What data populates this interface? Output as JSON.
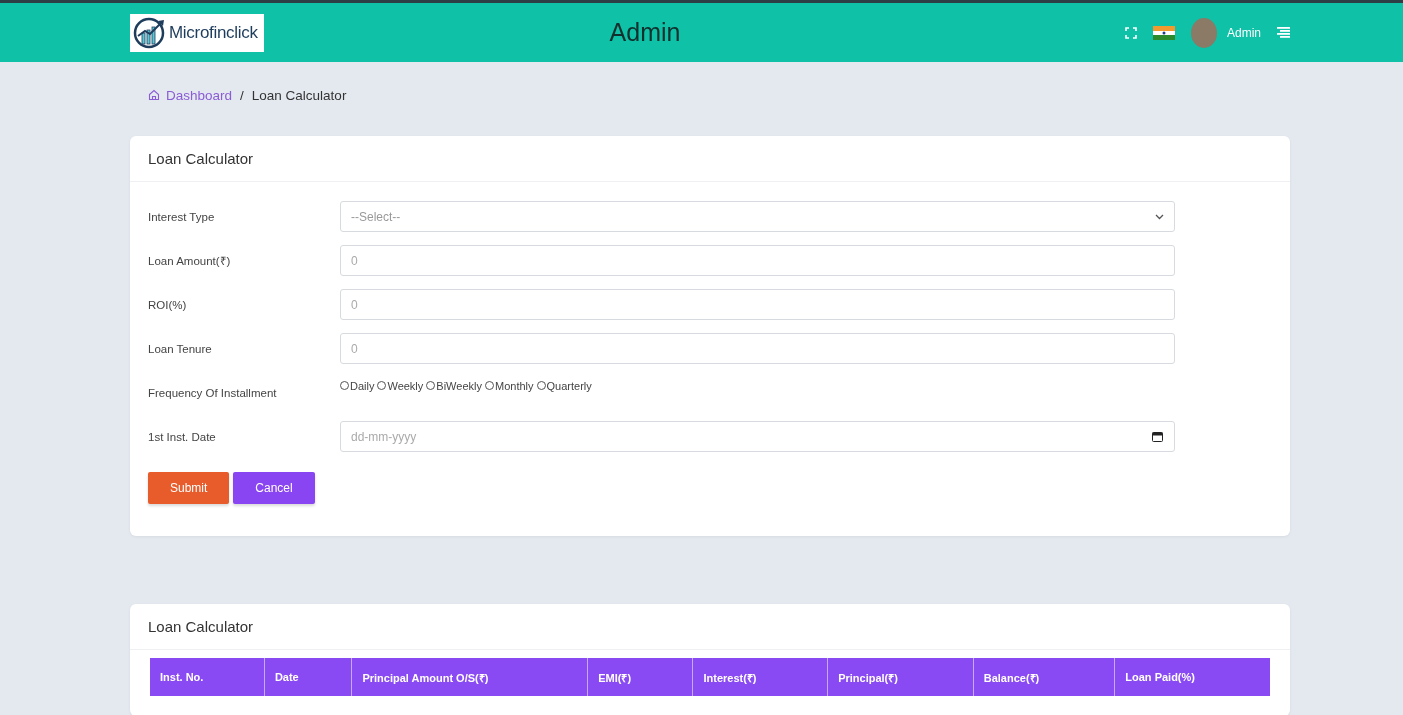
{
  "header": {
    "logo_text": "Microfinclick",
    "title": "Admin",
    "user_name": "Admin"
  },
  "breadcrumb": [
    {
      "label": "Dashboard",
      "kind": "link"
    },
    {
      "label": "/",
      "kind": "separator"
    },
    {
      "label": "Loan Calculator",
      "kind": "current"
    }
  ],
  "form": {
    "title": "Loan Calculator",
    "fields": [
      {
        "label": "Interest Type",
        "kind": "select",
        "value": "--Select--"
      },
      {
        "label": "Loan Amount(₹)",
        "kind": "text",
        "placeholder": "0"
      },
      {
        "label": "ROI(%)",
        "kind": "text",
        "placeholder": "0"
      },
      {
        "label": "Loan Tenure",
        "kind": "text",
        "placeholder": "0"
      },
      {
        "label": "Frequency Of Installment",
        "kind": "radio",
        "options": [
          {
            "label": "Daily",
            "selected": false
          },
          {
            "label": "Weekly",
            "selected": false
          },
          {
            "label": "BiWeekly",
            "selected": false
          },
          {
            "label": "Monthly",
            "selected": false
          },
          {
            "label": "Quarterly",
            "selected": false
          }
        ]
      },
      {
        "label": "1st Inst. Date",
        "kind": "date",
        "placeholder": "dd-mm-yyyy"
      }
    ],
    "buttons": [
      {
        "label": "Submit",
        "kind": "primary"
      },
      {
        "label": "Cancel",
        "kind": "secondary"
      }
    ]
  },
  "table": {
    "title": "Loan Calculator",
    "columns": [
      "Inst. No.",
      "Date",
      "Principal Amount O/S(₹)",
      "EMI(₹)",
      "Interest(₹)",
      "Principal(₹)",
      "Balance(₹)",
      "Loan Paid(%)"
    ]
  }
}
